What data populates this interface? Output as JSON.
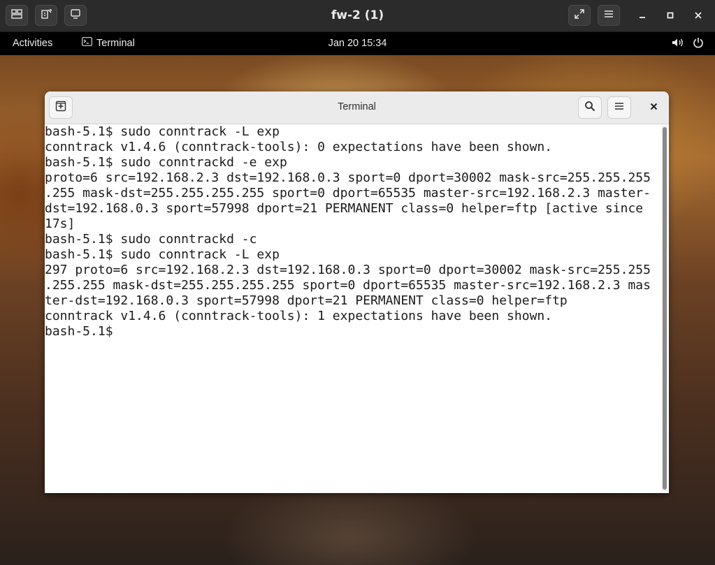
{
  "vm": {
    "title": "fw-2 (1)"
  },
  "topbar": {
    "activities": "Activities",
    "app_name": "Terminal",
    "clock": "Jan 20  15:34"
  },
  "terminal": {
    "title": "Terminal",
    "lines": [
      "bash-5.1$ sudo conntrack -L exp",
      "conntrack v1.4.6 (conntrack-tools): 0 expectations have been shown.",
      "bash-5.1$ sudo conntrackd -e exp",
      "proto=6 src=192.168.2.3 dst=192.168.0.3 sport=0 dport=30002 mask-src=255.255.255",
      ".255 mask-dst=255.255.255.255 sport=0 dport=65535 master-src=192.168.2.3 master-",
      "dst=192.168.0.3 sport=57998 dport=21 PERMANENT class=0 helper=ftp [active since",
      "17s]",
      "bash-5.1$ sudo conntrackd -c",
      "bash-5.1$ sudo conntrack -L exp",
      "297 proto=6 src=192.168.2.3 dst=192.168.0.3 sport=0 dport=30002 mask-src=255.255",
      ".255.255 mask-dst=255.255.255.255 sport=0 dport=65535 master-src=192.168.2.3 mas",
      "ter-dst=192.168.0.3 sport=57998 dport=21 PERMANENT class=0 helper=ftp",
      "conntrack v1.4.6 (conntrack-tools): 1 expectations have been shown."
    ],
    "prompt": "bash-5.1$ "
  },
  "icons": {
    "vm_btn1": "display-switch-icon",
    "vm_btn2": "usb-redirect-icon",
    "vm_btn3": "screen-icon",
    "fullscreen": "expand-icon",
    "menu": "hamburger-icon",
    "minimize": "minimize-icon",
    "maximize": "maximize-icon",
    "close": "close-icon",
    "volume": "volume-icon",
    "power": "power-icon",
    "new_tab": "new-tab-icon",
    "search": "search-icon"
  }
}
